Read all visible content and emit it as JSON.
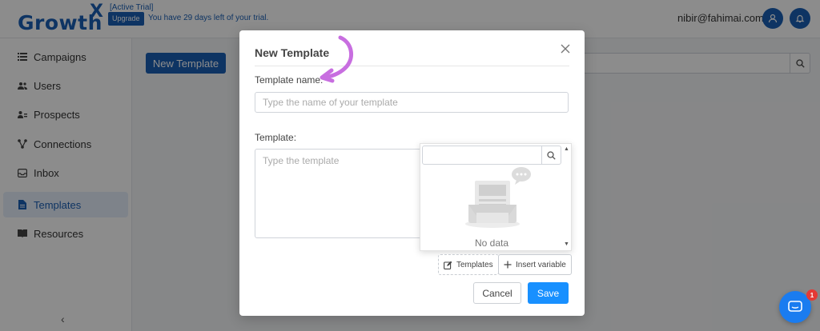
{
  "app": {
    "logo": "Growth",
    "logo_x": "X",
    "trial_label": "[Active Trial]",
    "upgrade_label": "Upgrade",
    "trial_text": "You have 29 days left of your trial.",
    "user_email": "nibir@fahimai.com"
  },
  "sidebar": {
    "items": [
      {
        "label": "Campaigns",
        "icon": "list-icon"
      },
      {
        "label": "Users",
        "icon": "users-icon"
      },
      {
        "label": "Prospects",
        "icon": "prospects-icon"
      },
      {
        "label": "Connections",
        "icon": "connections-icon"
      },
      {
        "label": "Inbox",
        "icon": "inbox-icon"
      },
      {
        "label": "Templates",
        "icon": "file-icon",
        "active": true
      },
      {
        "label": "Resources",
        "icon": "book-icon"
      }
    ]
  },
  "main": {
    "new_template_label": "New Template"
  },
  "modal": {
    "title": "New Template",
    "name_label": "Template name:",
    "name_placeholder": "Type the name of your template",
    "template_label": "Template:",
    "template_placeholder": "Type the template",
    "dropdown": {
      "empty_text": "No data"
    },
    "templates_btn": "Templates",
    "insert_variable_btn": "Insert variable",
    "cancel_label": "Cancel",
    "save_label": "Save"
  },
  "chat": {
    "badge_count": "1"
  },
  "colors": {
    "brand": "#1a5fb4",
    "primary": "#1890ff",
    "annotation": "#c86ee0",
    "badge": "#e53935"
  }
}
